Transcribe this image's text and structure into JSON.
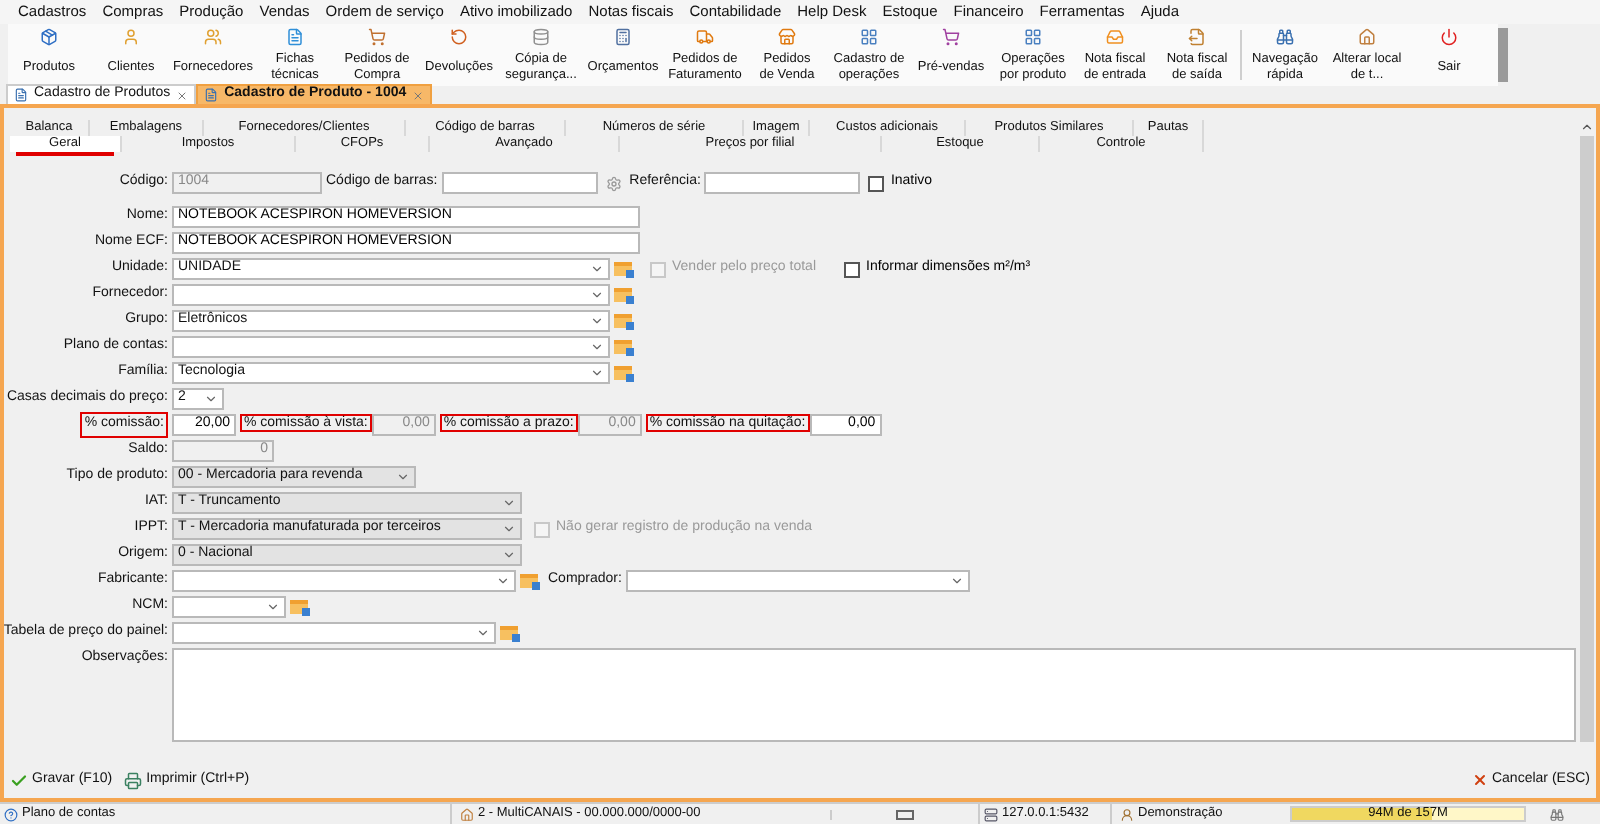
{
  "menu": [
    "Cadastros",
    "Compras",
    "Produção",
    "Vendas",
    "Ordem de serviço",
    "Ativo imobilizado",
    "Notas fiscais",
    "Contabilidade",
    "Help Desk",
    "Estoque",
    "Financeiro",
    "Ferramentas",
    "Ajuda"
  ],
  "toolbar": [
    {
      "lines": [
        "Produtos"
      ]
    },
    {
      "lines": [
        "Clientes"
      ]
    },
    {
      "lines": [
        "Fornecedores"
      ]
    },
    {
      "lines": [
        "Fichas",
        "técnicas"
      ]
    },
    {
      "lines": [
        "Pedidos de",
        "Compra"
      ]
    },
    {
      "lines": [
        "Devoluções"
      ]
    },
    {
      "lines": [
        "Cópia de",
        "segurança..."
      ]
    },
    {
      "lines": [
        "Orçamentos"
      ]
    },
    {
      "lines": [
        "Pedidos de",
        "Faturamento"
      ]
    },
    {
      "lines": [
        "Pedidos",
        "de Venda"
      ]
    },
    {
      "lines": [
        "Cadastro de",
        "operações"
      ]
    },
    {
      "lines": [
        "Pré-vendas"
      ]
    },
    {
      "lines": [
        "Operações",
        "por produto"
      ]
    },
    {
      "lines": [
        "Nota fiscal",
        "de entrada"
      ]
    },
    {
      "lines": [
        "Nota fiscal",
        "de saída"
      ]
    },
    {
      "lines": [
        "Navegação",
        "rápida"
      ]
    },
    {
      "lines": [
        "Alterar local",
        "de t..."
      ]
    },
    {
      "lines": [
        "Sair"
      ]
    }
  ],
  "doc_tabs": [
    {
      "label": "Cadastro de Produtos",
      "selected": false
    },
    {
      "label": "Cadastro de Produto - 1004",
      "selected": true
    }
  ],
  "tabs_row1": [
    {
      "label": "Balanca",
      "selected": false
    },
    {
      "label": "Embalagens",
      "selected": false
    },
    {
      "label": "Fornecedores/Clientes",
      "selected": false
    },
    {
      "label": "Código de barras",
      "selected": false
    },
    {
      "label": "Números de série",
      "selected": false
    },
    {
      "label": "Imagem",
      "selected": false
    },
    {
      "label": "Custos adicionais",
      "selected": false
    },
    {
      "label": "Produtos Similares",
      "selected": false
    },
    {
      "label": "Pautas",
      "selected": false
    }
  ],
  "tabs_row2": [
    {
      "label": "Geral",
      "selected": true
    },
    {
      "label": "Impostos",
      "selected": false
    },
    {
      "label": "CFOPs",
      "selected": false
    },
    {
      "label": "Avançado",
      "selected": false
    },
    {
      "label": "Preços por filial",
      "selected": false
    },
    {
      "label": "Estoque",
      "selected": false
    },
    {
      "label": "Controle",
      "selected": false
    }
  ],
  "form": {
    "codigo": {
      "label": "Código:",
      "value": "1004",
      "disabled": true
    },
    "codigo_barras": {
      "label": "Código de barras:"
    },
    "referencia": {
      "label": "Referência:"
    },
    "inativo": {
      "label": "Inativo",
      "checked": false
    },
    "nome": {
      "label": "Nome:",
      "value": "NOTEBOOK ACESPIRON HOMEVERSION"
    },
    "nome_ecf": {
      "label": "Nome ECF:",
      "value": "NOTEBOOK ACESPIRON HOMEVERSION"
    },
    "unidade": {
      "label": "Unidade:",
      "value": "UNIDADE"
    },
    "vender_preco_total": {
      "label": "Vender pelo preço total",
      "checked": false,
      "disabled": true
    },
    "informar_dimensoes": {
      "label": "Informar dimensões m²/m³",
      "checked": false
    },
    "fornecedor": {
      "label": "Fornecedor:"
    },
    "grupo": {
      "label": "Grupo:",
      "value": "Eletrônicos"
    },
    "plano_contas": {
      "label": "Plano de contas:"
    },
    "familia": {
      "label": "Família:",
      "value": "Tecnologia"
    },
    "casas_decimais": {
      "label": "Casas decimais do preço:",
      "value": "2"
    },
    "commissions": [
      {
        "label": "% comissão:",
        "value": "20,00",
        "highlighted": true,
        "disabled": false
      },
      {
        "label": "% comissão à vista:",
        "value": "0,00",
        "highlighted": true,
        "disabled": true
      },
      {
        "label": "% comissão a prazo:",
        "value": "0,00",
        "highlighted": true,
        "disabled": true
      },
      {
        "label": "% comissão na quitação:",
        "value": "0,00",
        "highlighted": true,
        "disabled": false
      }
    ],
    "saldo": {
      "label": "Saldo:",
      "value": "0",
      "disabled": true
    },
    "tipo_produto": {
      "label": "Tipo de produto:",
      "value": "00 - Mercadoria para revenda",
      "disabled": true
    },
    "iat": {
      "label": "IAT:",
      "value": "T - Truncamento",
      "disabled": true
    },
    "ippt": {
      "label": "IPPT:",
      "value": "T - Mercadoria manufaturada por terceiros",
      "disabled": true
    },
    "nao_gerar": {
      "label": "Não gerar registro de produção na venda",
      "checked": false,
      "disabled": true
    },
    "origem": {
      "label": "Origem:",
      "value": "0 - Nacional",
      "disabled": true
    },
    "fabricante": {
      "label": "Fabricante:"
    },
    "comprador": {
      "label": "Comprador:"
    },
    "ncm": {
      "label": "NCM:"
    },
    "tabela_preco": {
      "label": "Tabela de preço do painel:"
    },
    "observacoes": {
      "label": "Observações:"
    }
  },
  "actions": [
    {
      "label": "Gravar (F10)"
    },
    {
      "label": "Imprimir (Ctrl+P)"
    }
  ],
  "cancel": {
    "label": "Cancelar (ESC)"
  },
  "status_bar": {
    "left": "Plano de contas",
    "company": "2 - MultiCANAIS - 00.000.000/0000-00",
    "server": "127.0.0.1:5432",
    "user": "Demonstração",
    "memory": {
      "text": "94M de 157M",
      "level": 0.6
    }
  }
}
